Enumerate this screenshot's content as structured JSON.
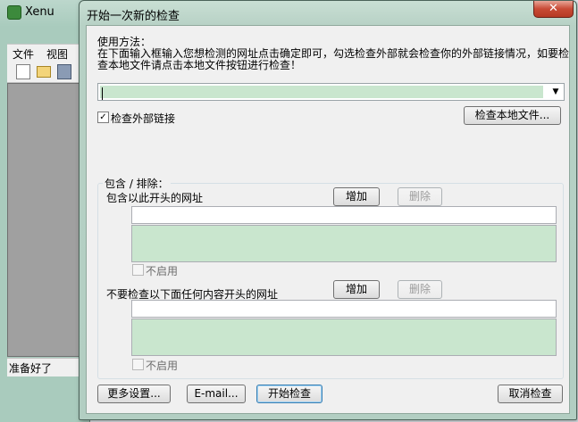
{
  "background_app": {
    "title": "Xenu",
    "menu": [
      "文件",
      "视图"
    ],
    "status": "准备好了"
  },
  "dialog": {
    "title": "开始一次新的检查",
    "close_glyph": "✕",
    "instructions_title": "使用方法：",
    "instructions_line1": "在下面输入框输入您想检测的网址点击确定即可，勾选检查外部就会检查你的外部链接情况，如要检",
    "instructions_line2": "查本地文件请点击本地文件按钮进行检查！",
    "url_input_value": "",
    "check_external_label": "检查外部链接",
    "check_external_checked": true,
    "check_local_button": "检查本地文件...",
    "include_exclude_label": "包含 / 排除：",
    "include": {
      "label": "包含以此开头的网址",
      "add_button": "增加",
      "delete_button": "删除",
      "input_value": "",
      "disable_label": "不启用"
    },
    "exclude": {
      "label": "不要检查以下面任何内容开头的网址",
      "add_button": "增加",
      "delete_button": "删除",
      "input_value": "",
      "disable_label": "不启用"
    },
    "buttons": {
      "more_settings": "更多设置...",
      "email": "E-mail...",
      "start": "开始检查",
      "cancel": "取消检查"
    }
  },
  "colors": {
    "accent_green": "#c9e6ce",
    "close_red": "#c84a35"
  }
}
